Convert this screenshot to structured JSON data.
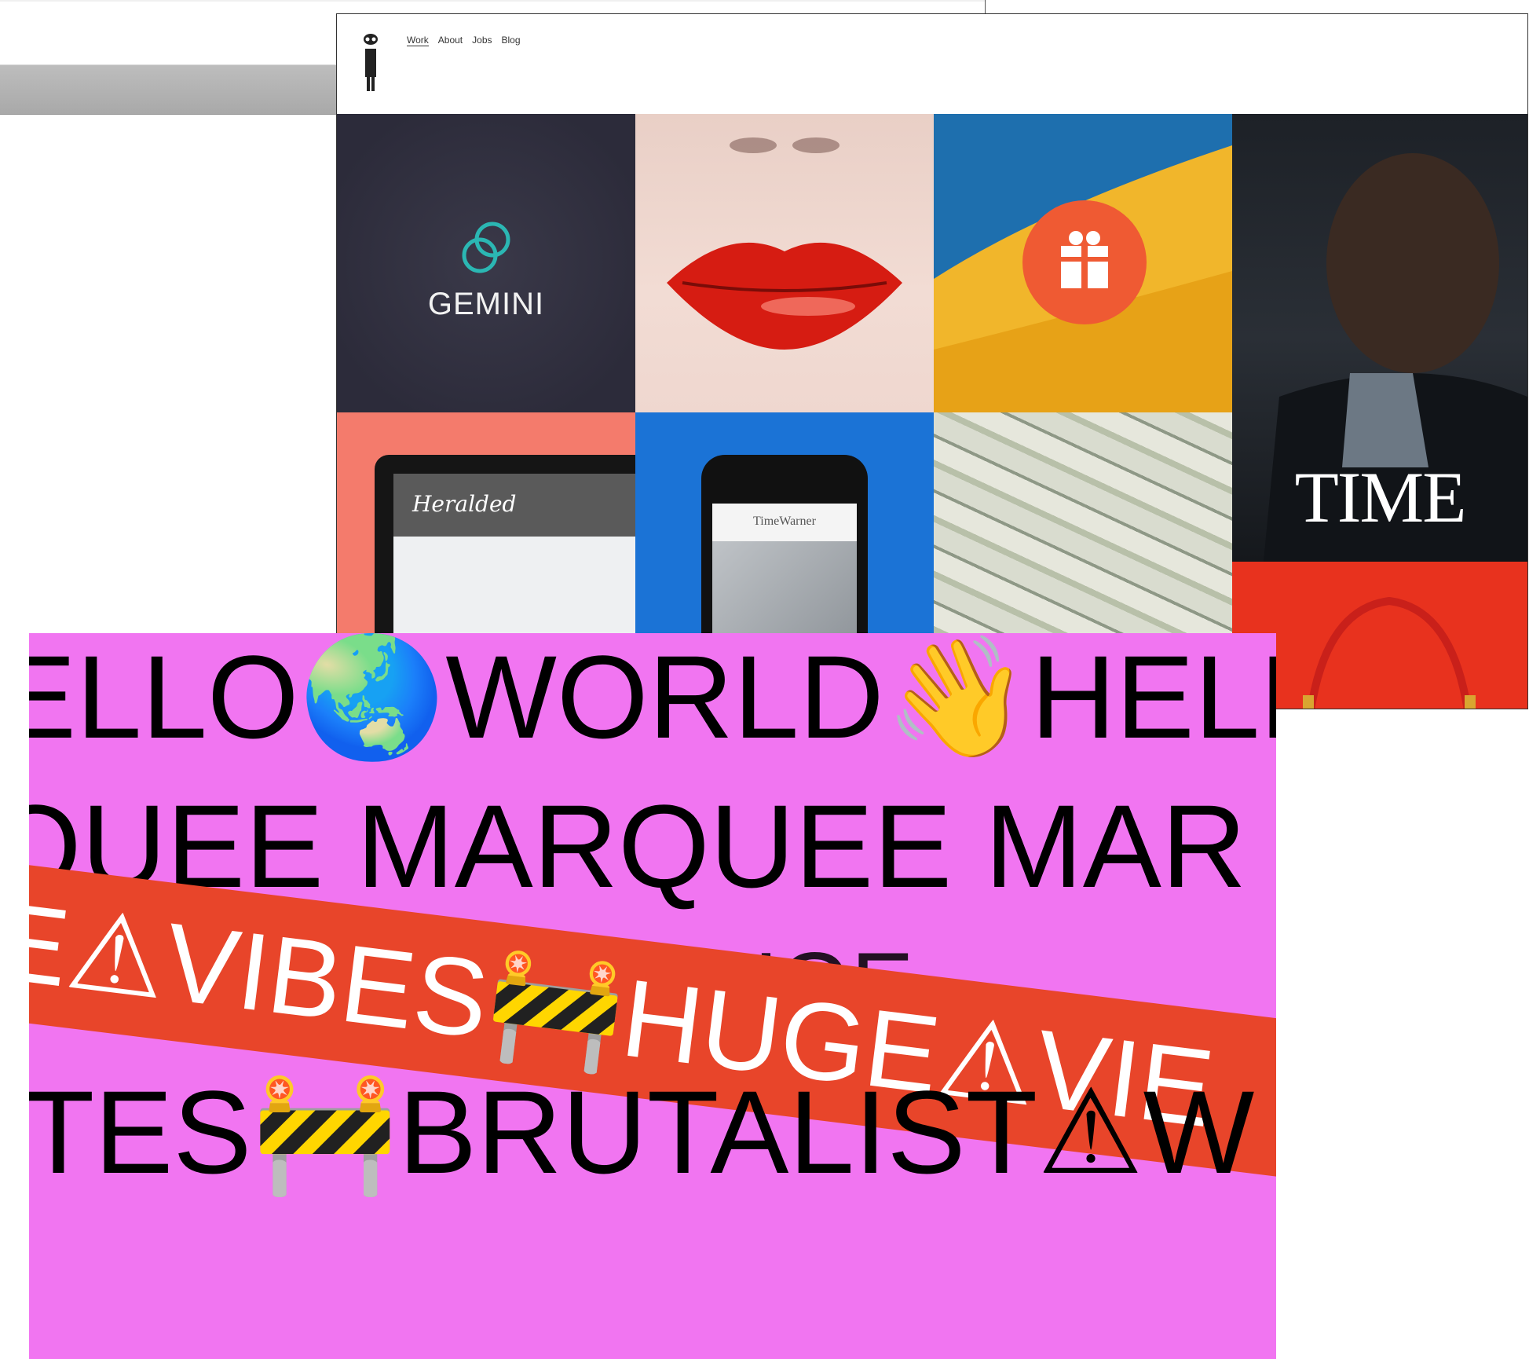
{
  "portfolio": {
    "nav": [
      "Work",
      "About",
      "Jobs",
      "Blog"
    ],
    "tiles": {
      "gemini_wordmark": "GEMINI",
      "time_wordmark": "TIME",
      "tablet_script": "Heralded",
      "phone_brand": "TimeWarner"
    }
  },
  "poster": {
    "line1": [
      "ELLO",
      "WORLD",
      "HELL"
    ],
    "line1_emoji": [
      "🌏",
      "👋"
    ],
    "line2": "QUEE MARQUEE MAR",
    "band": [
      "E",
      "VIBES",
      "HUGE",
      "VIE"
    ],
    "band_emoji": [
      "⚠",
      "🚧",
      "⚠"
    ],
    "line4": [
      "ITES",
      "BRUTALIST",
      "W"
    ],
    "line4_emoji": [
      "🚧",
      "⚠"
    ],
    "ghost": "HUGE"
  },
  "colors": {
    "poster_bg": "#f175f1",
    "band": "#e8452a",
    "gift": "#ef5a33",
    "gemini_teal": "#2bb7b3"
  },
  "icons": [
    "logo-figure-icon",
    "gemini-logo-icon",
    "gift-box-icon"
  ]
}
